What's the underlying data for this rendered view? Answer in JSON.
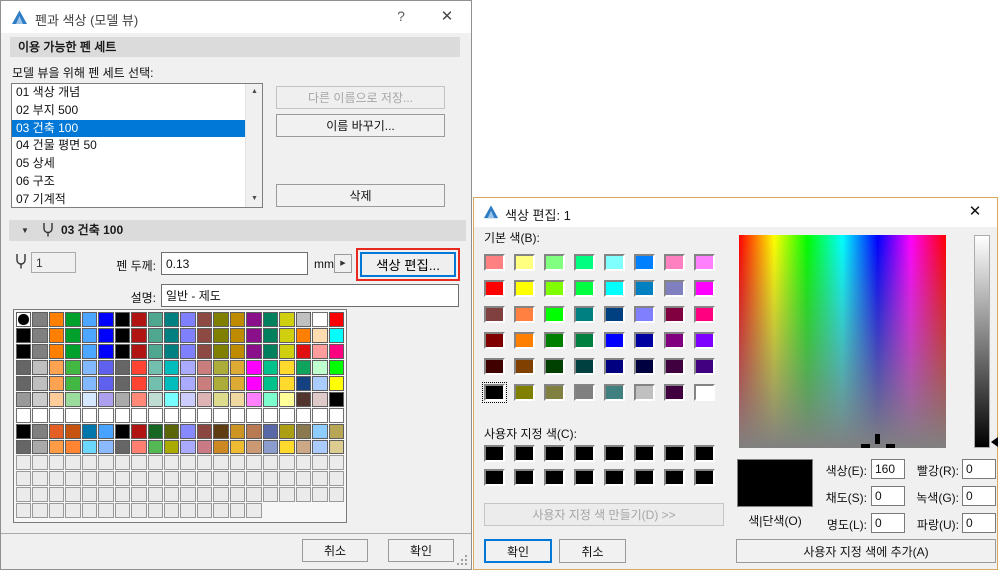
{
  "left_dialog": {
    "title": "펜과 색상 (모델 뷰)",
    "help_icon": "?",
    "close_icon": "✕",
    "available_header": "이용 가능한 펜 세트",
    "list_label": "모델 뷰을 위해 펜 세트 선택:",
    "pen_sets": [
      {
        "label": "01 색상 개념",
        "selected": false
      },
      {
        "label": "02 부지 500",
        "selected": false
      },
      {
        "label": "03 건축 100",
        "selected": true
      },
      {
        "label": "04 건물 평면 50",
        "selected": false
      },
      {
        "label": "05 상세",
        "selected": false
      },
      {
        "label": "06 구조",
        "selected": false
      },
      {
        "label": "07 기계적",
        "selected": false
      }
    ],
    "save_as_button": "다른 이름으로 저장...",
    "rename_button": "이름 바꾸기...",
    "delete_button": "삭제",
    "current_set_header": "03 건축 100",
    "pen_number": "1",
    "thickness_label": "펜 두께:",
    "thickness_value": "0.13",
    "unit": "mm",
    "edit_color_button": "색상 편집...",
    "description_label": "설명:",
    "description_value": "일반 - 제도",
    "cancel_button": "취소",
    "ok_button": "확인",
    "selection_color": "#0078D7",
    "annotation_color": "#E8291F",
    "palette": {
      "columns": 20,
      "rows": [
        [
          "#000000",
          "#808080",
          "#FF7F00",
          "#00A02C",
          "#4DA6FF",
          "#0000FF",
          "#000000",
          "#B01513",
          "#4FA78F",
          "#008080",
          "#8080FF",
          "#8C4A42",
          "#808000",
          "#BD8A00",
          "#8A0F8A",
          "#00805C",
          "#CFCF10",
          "#C0C0C0",
          "#FFFFFF",
          "#FF0000"
        ],
        [
          "#000000",
          "#808080",
          "#FF7F00",
          "#00A02C",
          "#4DA6FF",
          "#0000FF",
          "#000000",
          "#B01513",
          "#4FA78F",
          "#008080",
          "#8080FF",
          "#8C4A42",
          "#808000",
          "#BD8A00",
          "#8A0F8A",
          "#00805C",
          "#CFCF10",
          "#FF8000",
          "#FFDCB0",
          "#00FFFF"
        ],
        [
          "#000000",
          "#808080",
          "#FF7F00",
          "#00A02C",
          "#4DA6FF",
          "#0000FF",
          "#000000",
          "#B01513",
          "#4FA78F",
          "#008080",
          "#8080FF",
          "#8C4A42",
          "#808000",
          "#BD8A00",
          "#8A0F8A",
          "#00805C",
          "#CFCF10",
          "#E01010",
          "#FF9C9C",
          "#FF0080"
        ],
        [
          "#666666",
          "#BFBFBF",
          "#FFA352",
          "#42B742",
          "#82B8FF",
          "#6060EE",
          "#666666",
          "#FF4433",
          "#72BFAD",
          "#00BDBD",
          "#AAAAFF",
          "#C97D7D",
          "#ACAC3B",
          "#DDAA33",
          "#FF00FF",
          "#00C28A",
          "#FFD92B",
          "#10A35C",
          "#BFFFCF",
          "#00FF00"
        ],
        [
          "#666666",
          "#BFBFBF",
          "#FFA352",
          "#42B742",
          "#82B8FF",
          "#6060EE",
          "#666666",
          "#FF4433",
          "#72BFAD",
          "#00BDBD",
          "#AAAAFF",
          "#C97D7D",
          "#ACAC3B",
          "#DDAA33",
          "#FF00FF",
          "#00C28A",
          "#FFD92B",
          "#14417F",
          "#AACCFF",
          "#FFFF00"
        ],
        [
          "#999999",
          "#CCCCCC",
          "#FFCC99",
          "#9BDB9B",
          "#D5E8FF",
          "#AC9FEE",
          "#AAAAAA",
          "#FF8877",
          "#BFDCD2",
          "#77FFFF",
          "#CCCCFF",
          "#DDB3B3",
          "#DCDC8C",
          "#EFD9A0",
          "#FF80FF",
          "#7CFFCC",
          "#FFFF99",
          "#52362E",
          "#DFC9C9",
          "#000000"
        ],
        [
          "#FFFFFF",
          "#FFFFFF",
          "#FFFFFF",
          "#FFFFFF",
          "#FFFFFF",
          "#FFFFFF",
          "#FFFFFF",
          "#FFFFFF",
          "#FFFFFF",
          "#FFFFFF",
          "#FFFFFF",
          "#FFFFFF",
          "#FFFFFF",
          "#FFFFFF",
          "#FFFFFF",
          "#FFFFFF",
          "#FFFFFF",
          "#FFFFFF",
          "#FFFFFF",
          "#FFFFFF"
        ],
        [
          "#000000",
          "#808080",
          "#E35F26",
          "#C65310",
          "#0077AC",
          "#47A3FF",
          "#000000",
          "#B01513",
          "#176623",
          "#5A6608",
          "#8888FF",
          "#8C4642",
          "#5E3D12",
          "#CC9422",
          "#B87A52",
          "#5969A8",
          "#AC9F14",
          "#8C7A4F",
          "#8FCCFF",
          "#B8A657"
        ],
        [
          "#666666",
          "#AAAAAA",
          "#FF9C45",
          "#FF8533",
          "#6BD7FF",
          "#8CBAFF",
          "#666666",
          "#FF8070",
          "#54B854",
          "#AAAA00",
          "#AAAAFF",
          "#C97A85",
          "#CC8921",
          "#EEBB33",
          "#CC9975",
          "#8C9CCC",
          "#FFD92B",
          "#CCA886",
          "#AACCFF",
          "#DCCC90"
        ]
      ],
      "empty_full_rows": 3,
      "empty_last_row_cells": 15,
      "empty_fill": "#EBEBEB"
    }
  },
  "right_dialog": {
    "title": "색상 편집: 1",
    "close_icon": "✕",
    "basic_label": "기본 색(B):",
    "basic_colors": [
      "#FF8080",
      "#FFFF80",
      "#80FF80",
      "#00FF80",
      "#80FFFF",
      "#0080FF",
      "#FF80C0",
      "#FF80FF",
      "#FF0000",
      "#FFFF00",
      "#80FF00",
      "#00FF40",
      "#00FFFF",
      "#0080C0",
      "#8080C0",
      "#FF00FF",
      "#804040",
      "#FF8040",
      "#00FF00",
      "#008080",
      "#004080",
      "#8080FF",
      "#800040",
      "#FF0080",
      "#800000",
      "#FF8000",
      "#008000",
      "#008040",
      "#0000FF",
      "#0000A0",
      "#800080",
      "#8000FF",
      "#400000",
      "#804000",
      "#004000",
      "#004040",
      "#000080",
      "#000040",
      "#400040",
      "#400080",
      "#000000",
      "#808000",
      "#808040",
      "#808080",
      "#408080",
      "#C0C0C0",
      "#400040",
      "#FFFFFF"
    ],
    "basic_selected_index": 40,
    "custom_label": "사용자 지정 색(C):",
    "custom_colors": [
      "#000000",
      "#000000",
      "#000000",
      "#000000",
      "#000000",
      "#000000",
      "#000000",
      "#000000",
      "#000000",
      "#000000",
      "#000000",
      "#000000",
      "#000000",
      "#000000",
      "#000000",
      "#000000"
    ],
    "define_custom_button": "사용자 지정 색 만들기(D) >>",
    "preview_color": "#000000",
    "preview_label": "색|단색(O)",
    "hsl_fields": [
      {
        "label": "색상(E):",
        "value": "160"
      },
      {
        "label": "채도(S):",
        "value": "0"
      },
      {
        "label": "명도(L):",
        "value": "0"
      }
    ],
    "rgb_fields": [
      {
        "label": "빨강(R):",
        "value": "0"
      },
      {
        "label": "녹색(G):",
        "value": "0"
      },
      {
        "label": "파랑(U):",
        "value": "0"
      }
    ],
    "ok_button": "확인",
    "cancel_button": "취소",
    "add_custom_button": "사용자 지정 색에 추가(A)",
    "accent_color": "#0078D7"
  }
}
